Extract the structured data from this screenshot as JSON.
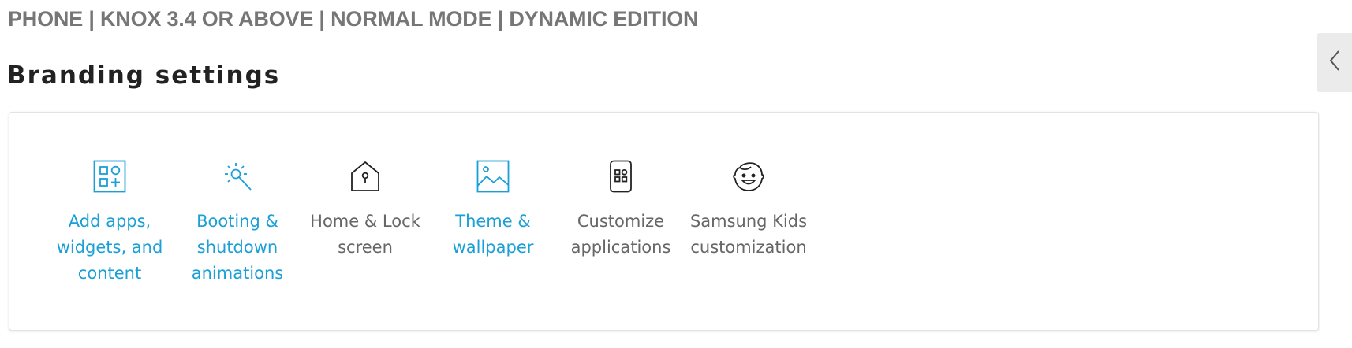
{
  "breadcrumb": "PHONE | KNOX 3.4 OR ABOVE | NORMAL MODE | DYNAMIC EDITION",
  "page_title": "Branding settings",
  "colors": {
    "link": "#1a9fd6",
    "plain_text": "#666666",
    "icon_dark": "#222222"
  },
  "tiles": [
    {
      "label": "Add apps, widgets, and content",
      "icon": "add-apps-widgets-icon",
      "style": "link"
    },
    {
      "label": "Booting & shutdown animations",
      "icon": "magic-wand-icon",
      "style": "link"
    },
    {
      "label": "Home & Lock screen",
      "icon": "home-lock-icon",
      "style": "plain"
    },
    {
      "label": "Theme & wallpaper",
      "icon": "image-icon",
      "style": "link"
    },
    {
      "label": "Customize applications",
      "icon": "phone-apps-icon",
      "style": "plain"
    },
    {
      "label": "Samsung Kids customization",
      "icon": "kid-face-icon",
      "style": "plain"
    }
  ]
}
